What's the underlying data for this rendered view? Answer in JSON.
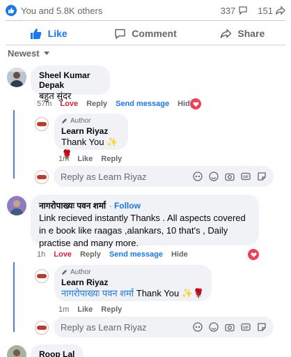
{
  "stats": {
    "reactors": "You and 5.8K others",
    "comments": "337",
    "shares": "151"
  },
  "actions": {
    "like": "Like",
    "comment": "Comment",
    "share": "Share"
  },
  "sort": {
    "label": "Newest"
  },
  "comment1": {
    "name": "Sheel Kumar Depak",
    "text": "बहुत सुंदर",
    "time": "57m",
    "love": "Love",
    "reply": "Reply",
    "send": "Send message",
    "hide": "Hide"
  },
  "reply1": {
    "badge": "Author",
    "name": "Learn Riyaz",
    "text": "Thank You ✨🌹",
    "time": "1m",
    "like": "Like",
    "reply": "Reply"
  },
  "replybox1": {
    "placeholder": "Reply as Learn Riyaz"
  },
  "comment2": {
    "name": "नागरोपाख्यः पवन शर्मा",
    "follow": "Follow",
    "text": "Link recieved instantly Thanks . All aspects covered in e book like raagas ,alankars, 10 that's , Daily practise and many more.",
    "time": "1h",
    "love": "Love",
    "reply": "Reply",
    "send": "Send message",
    "hide": "Hide"
  },
  "reply2": {
    "badge": "Author",
    "name": "Learn Riyaz",
    "mention": "नागरोपाख्यः पवन शर्मा",
    "text": "Thank You ✨🌹",
    "time": "1m",
    "like": "Like",
    "reply": "Reply"
  },
  "replybox2": {
    "placeholder": "Reply as Learn Riyaz"
  },
  "comment3": {
    "name": "Roop Lal"
  }
}
